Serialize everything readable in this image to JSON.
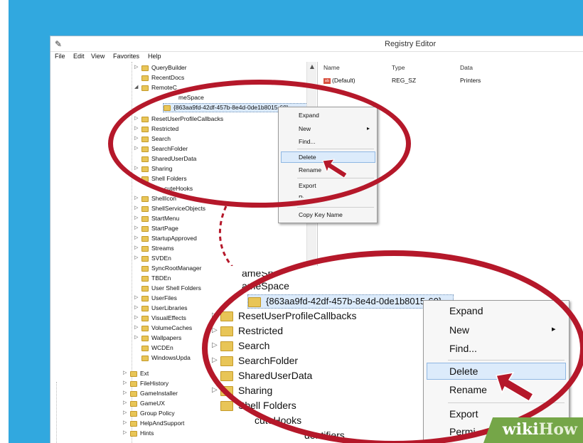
{
  "window": {
    "title": "Registry Editor",
    "icon": "regedit-icon"
  },
  "menu": {
    "items": [
      "File",
      "Edit",
      "View",
      "Favorites",
      "Help"
    ]
  },
  "tree": {
    "items": [
      {
        "label": "QueryBuilder"
      },
      {
        "label": "RecentDocs"
      },
      {
        "label": "RemoteC"
      },
      {
        "label": "meSpace"
      },
      {
        "label": "{863aa9fd-42df-457b-8e4d-0de1b8015-60}"
      },
      {
        "label": "ResetUserProfileCallbacks"
      },
      {
        "label": "Restricted"
      },
      {
        "label": "Search"
      },
      {
        "label": "SearchFolder"
      },
      {
        "label": "SharedUserData"
      },
      {
        "label": "Sharing"
      },
      {
        "label": "Shell Folders"
      },
      {
        "label": "cuteHooks"
      },
      {
        "label": "ShellIcon"
      },
      {
        "label": "ShellServiceObjects"
      },
      {
        "label": "StartMenu"
      },
      {
        "label": "StartPage"
      },
      {
        "label": "StartupApproved"
      },
      {
        "label": "Streams"
      },
      {
        "label": "SVDEn"
      },
      {
        "label": "SyncRootManager"
      },
      {
        "label": "TBDEn"
      },
      {
        "label": "User Shell Folders"
      },
      {
        "label": "UserFiles"
      },
      {
        "label": "UserLibraries"
      },
      {
        "label": "VisualEffects"
      },
      {
        "label": "VolumeCaches"
      },
      {
        "label": "Wallpapers"
      },
      {
        "label": "WCDEn"
      },
      {
        "label": "WindowsUpda"
      },
      {
        "label": "Ext"
      },
      {
        "label": "FileHistory"
      },
      {
        "label": "GameInstaller"
      },
      {
        "label": "GameUX"
      },
      {
        "label": "Group Policy"
      },
      {
        "label": "HelpAndSupport"
      },
      {
        "label": "Hints"
      }
    ]
  },
  "list": {
    "columns": [
      "Name",
      "Type",
      "Data"
    ],
    "rows": [
      {
        "name": "(Default)",
        "type": "REG_SZ",
        "data": "Printers"
      }
    ]
  },
  "context_menu": {
    "items": [
      "Expand",
      "New",
      "Find...",
      "Delete",
      "Rename",
      "Export",
      "Permi",
      "Copy Key Name"
    ],
    "highlighted": "Delete",
    "submenu_marker": "▸"
  },
  "zoom": {
    "items": [
      {
        "label": "ameSpace"
      },
      {
        "label": "{863aa9fd-42df-457b-8e4d-0de1b8015-60}"
      },
      {
        "label": "ResetUserProfileCallbacks"
      },
      {
        "label": "Restricted"
      },
      {
        "label": "Search"
      },
      {
        "label": "SearchFolder"
      },
      {
        "label": "SharedUserData"
      },
      {
        "label": "Sharing"
      },
      {
        "label": "Shell Folders"
      },
      {
        "label": "cuteHooks"
      },
      {
        "label": "dentifiers"
      }
    ],
    "context_menu": [
      "Expand",
      "New",
      "Find...",
      "Delete",
      "Rename",
      "Export",
      "Permi"
    ]
  },
  "watermark": {
    "wiki": "wiki",
    "how": "How"
  },
  "colors": {
    "background_blue": "#31a8df",
    "highlight_ring": "#b5182a",
    "selection": "#dcebfb",
    "watermark_green": "#75a648"
  }
}
